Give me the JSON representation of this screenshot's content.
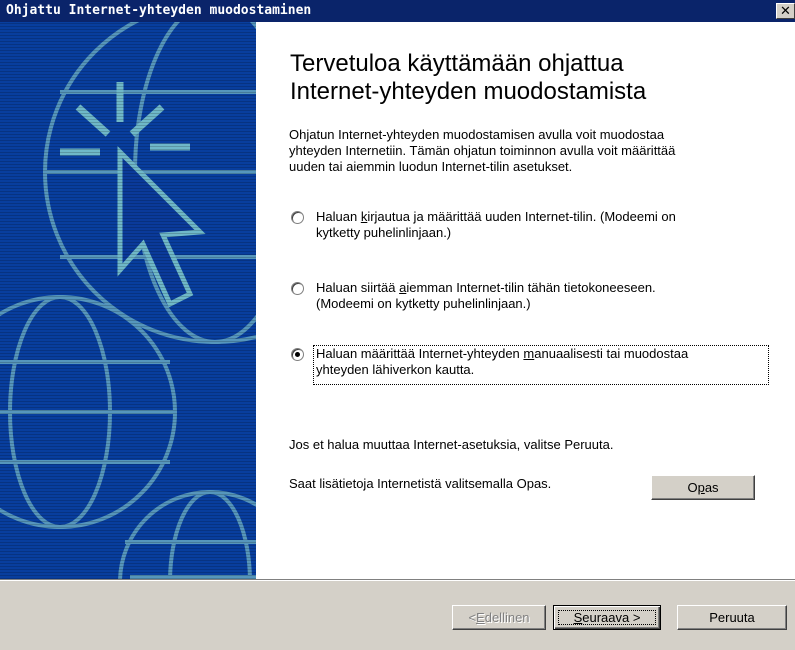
{
  "window": {
    "title": "Ohjattu Internet-yhteyden muodostaminen",
    "close_glyph": "✕"
  },
  "heading": {
    "line1": "Tervetuloa käyttämään ohjattua",
    "line2": "Internet-yhteyden muodostamista"
  },
  "intro": {
    "line1": "Ohjatun Internet-yhteyden muodostamisen avulla voit muodostaa",
    "line2": "yhteyden Internetiin. Tämän ohjatun toiminnon avulla voit määrittää",
    "line3": "uuden tai aiemmin luodun Internet-tilin asetukset."
  },
  "options": [
    {
      "pre": "Haluan ",
      "mnemonic": "k",
      "post": "irjautua ja määrittää uuden Internet-tilin. (Modeemi on",
      "line2": "kytketty puhelinlinjaan.)",
      "selected": false
    },
    {
      "pre": "Haluan siirtää ",
      "mnemonic": "a",
      "post": "iemman Internet-tilin tähän tietokoneeseen.",
      "line2": "(Modeemi on kytketty puhelinlinjaan.)",
      "selected": false
    },
    {
      "pre": "Haluan määrittää Internet-yhteyden ",
      "mnemonic": "m",
      "post": "anuaalisesti tai muodostaa",
      "line2": "yhteyden lähiverkon kautta.",
      "selected": true
    }
  ],
  "cancel_hint": "Jos et halua muuttaa Internet-asetuksia, valitse Peruuta.",
  "help_hint": "Saat lisätietoja Internetistä valitsemalla Opas.",
  "buttons": {
    "help": {
      "mnemonic": "p",
      "pre": "O",
      "post": "as"
    },
    "back": {
      "pre": "< ",
      "mnemonic": "E",
      "post": "dellinen"
    },
    "next": {
      "mnemonic": "S",
      "post": "euraava >"
    },
    "cancel": {
      "label": "Peruuta"
    }
  },
  "colors": {
    "titlebar": "#0a246a",
    "art_background": "#083e9e",
    "art_lines": "#5fa0c0"
  }
}
